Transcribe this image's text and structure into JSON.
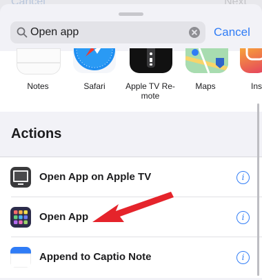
{
  "behind": {
    "left_label": "Cancel",
    "right_label": "Next"
  },
  "search": {
    "value": "Open app",
    "cancel_label": "Cancel"
  },
  "apps": [
    {
      "label": "Notes",
      "icon": "notes-app-icon"
    },
    {
      "label": "Safari",
      "icon": "safari-compass-icon"
    },
    {
      "label": "Apple TV Re-\nmote",
      "icon": "apple-tv-remote-icon"
    },
    {
      "label": "Maps",
      "icon": "maps-app-icon"
    },
    {
      "label": "Insta",
      "icon": "instagram-app-icon"
    }
  ],
  "actions": {
    "title": "Actions",
    "items": [
      {
        "label": "Open App on Apple TV",
        "icon": "apple-tv-screen-icon",
        "info": "i"
      },
      {
        "label": "Open App",
        "icon": "app-grid-icon",
        "info": "i"
      },
      {
        "label": "Append to Captio Note",
        "icon": "captio-note-icon",
        "info": "i"
      }
    ]
  },
  "colors": {
    "accent": "#2f7cf6",
    "arrow": "#e5242b"
  }
}
